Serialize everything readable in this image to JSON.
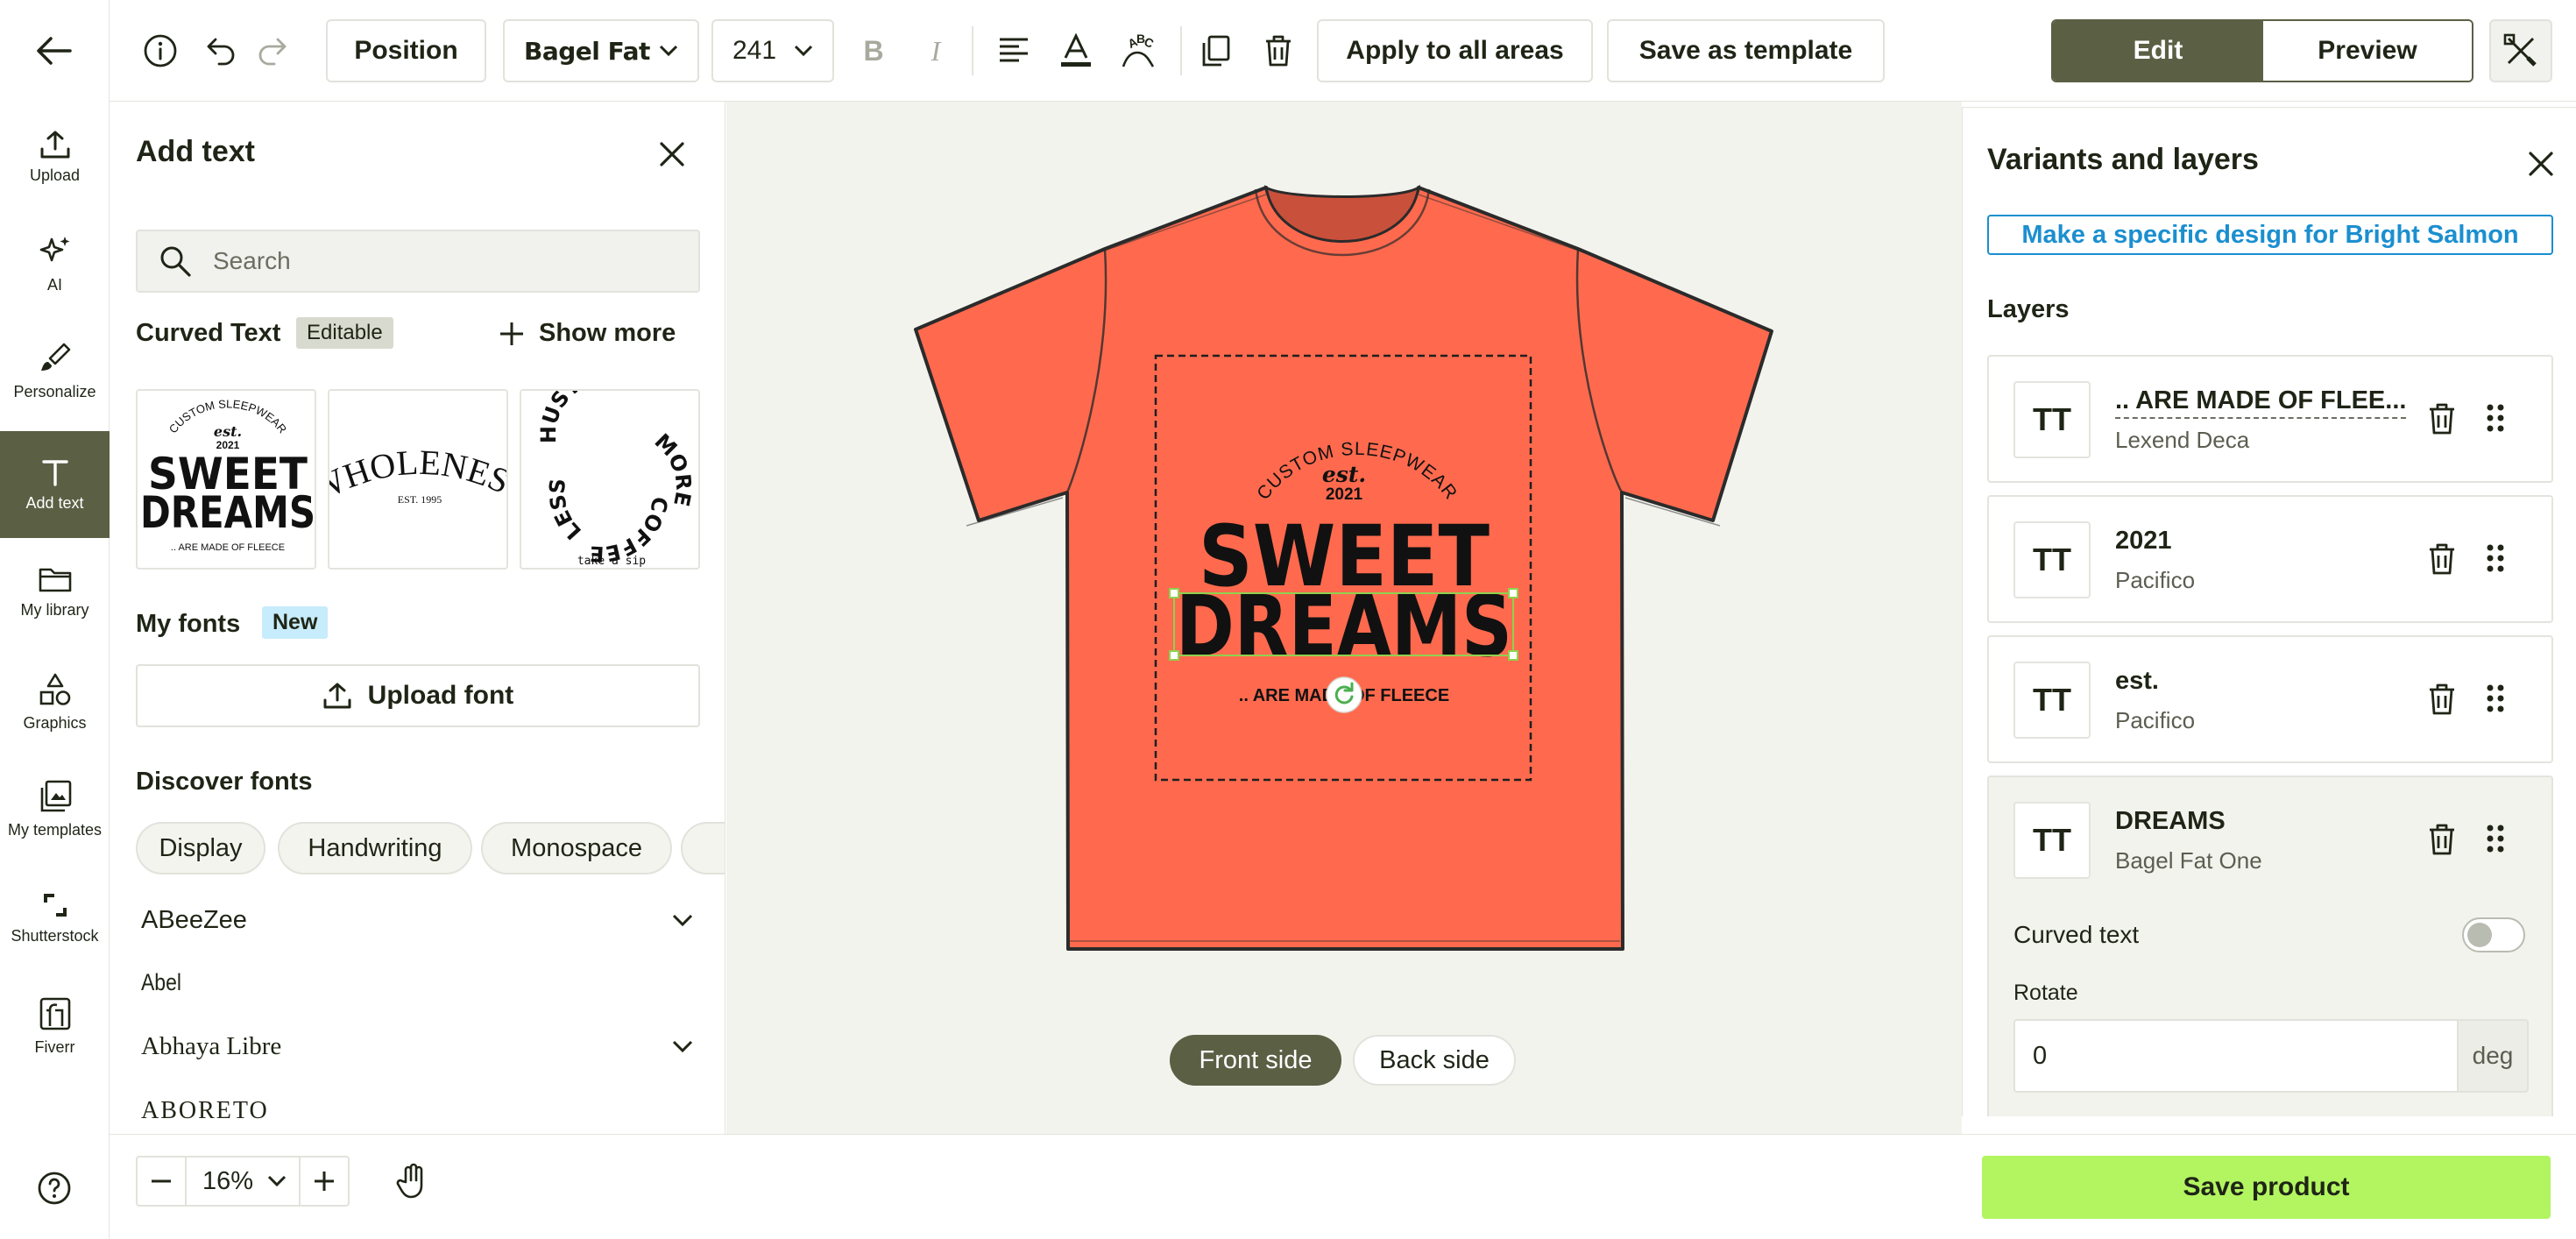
{
  "rail": {
    "items": [
      {
        "label": "Upload"
      },
      {
        "label": "AI"
      },
      {
        "label": "Personalize"
      },
      {
        "label": "Add text"
      },
      {
        "label": "My library"
      },
      {
        "label": "Graphics"
      },
      {
        "label": "My templates"
      },
      {
        "label": "Shutterstock"
      },
      {
        "label": "Fiverr"
      }
    ]
  },
  "toolbar": {
    "position_label": "Position",
    "font_name": "Bagel Fat",
    "font_size": "241",
    "apply_all_label": "Apply to all areas",
    "save_template_label": "Save as template",
    "edit_label": "Edit",
    "preview_label": "Preview"
  },
  "add_text": {
    "title": "Add text",
    "search_placeholder": "Search",
    "curved_title": "Curved Text",
    "editable_badge": "Editable",
    "show_more_label": "Show more",
    "cards": [
      {
        "top": "CUSTOM SLEEPWEAR",
        "est": "est.",
        "year": "2021",
        "line1": "SWEET",
        "line2": "DREAMS",
        "bottom": ".. ARE MADE OF FLEECE"
      },
      {
        "arc": "WHOLENESS",
        "sub": "EST. 1995"
      },
      {
        "words": [
          "HUSTLE",
          "MORE",
          "COFFEE",
          "LESS"
        ],
        "sub": "take a sip"
      }
    ],
    "my_fonts_title": "My fonts",
    "new_badge": "New",
    "upload_font_label": "Upload font",
    "discover_title": "Discover fonts",
    "chips": [
      "Display",
      "Handwriting",
      "Monospace"
    ],
    "fonts": [
      "ABeeZee",
      "Abel",
      "Abhaya Libre",
      "ABORETO"
    ]
  },
  "canvas": {
    "design": {
      "top_arc": "CUSTOM SLEEPWEAR",
      "est": "est.",
      "year": "2021",
      "line1": "SWEET",
      "line2": "DREAMS",
      "bottom": ".. ARE MADE OF FLEECE"
    },
    "front_label": "Front side",
    "back_label": "Back side",
    "shirt_color": "#ff6a4e"
  },
  "bottom": {
    "zoom": "16%",
    "save_label": "Save product"
  },
  "layers_panel": {
    "title": "Variants and layers",
    "specific_design_label": "Make a specific design for Bright Salmon",
    "layers_title": "Layers",
    "layers": [
      {
        "name": ".. ARE MADE OF FLEE...",
        "font": "Lexend Deca"
      },
      {
        "name": "2021",
        "font": "Pacifico"
      },
      {
        "name": "est.",
        "font": "Pacifico"
      },
      {
        "name": "DREAMS",
        "font": "Bagel Fat One"
      }
    ],
    "tt_glyph": "TT",
    "curved_text_label": "Curved text",
    "rotate_label": "Rotate",
    "rotate_value": "0",
    "rotate_unit": "deg"
  },
  "colors": {
    "accent_olive": "#5b5f44",
    "save_green": "#b2f561",
    "link_blue": "#1b8fcf",
    "shirt_salmon": "#ff6a4e"
  }
}
